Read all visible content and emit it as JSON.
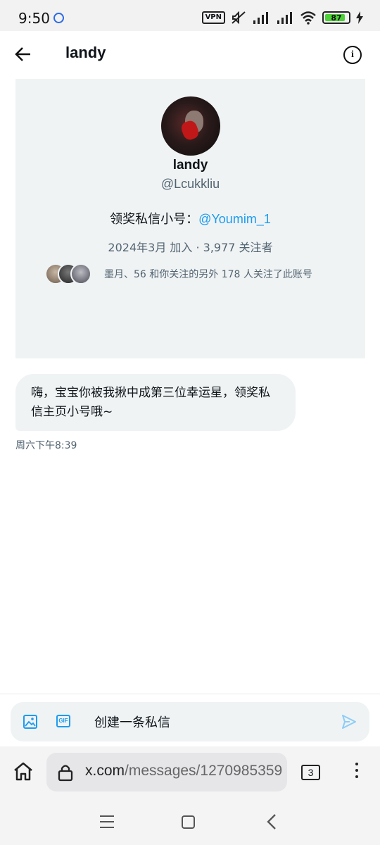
{
  "status_bar": {
    "time": "9:50",
    "vpn": "VPN",
    "battery": "87"
  },
  "header": {
    "title": "landy"
  },
  "profile": {
    "name": "landy",
    "handle": "@Lcukkliu",
    "bio_prefix": "领奖私信小号：",
    "bio_mention": "@Youmim_1",
    "meta": "2024年3月 加入 · 3,977 关注者",
    "followed_by": "墨月、56 和你关注的另外 178 人关注了此账号"
  },
  "message": {
    "text": "嗨，宝宝你被我揪中成第三位幸运星，领奖私信主页小号哦~",
    "timestamp": "周六下午8:39"
  },
  "composer": {
    "placeholder": "创建一条私信",
    "gif_label": "GIF"
  },
  "browser": {
    "url_host": "x.com",
    "url_path": "/messages/1270985359",
    "tab_count": "3"
  },
  "colors": {
    "accent": "#1d9bf0",
    "card_bg": "#eff3f4",
    "secondary_text": "#536471"
  }
}
